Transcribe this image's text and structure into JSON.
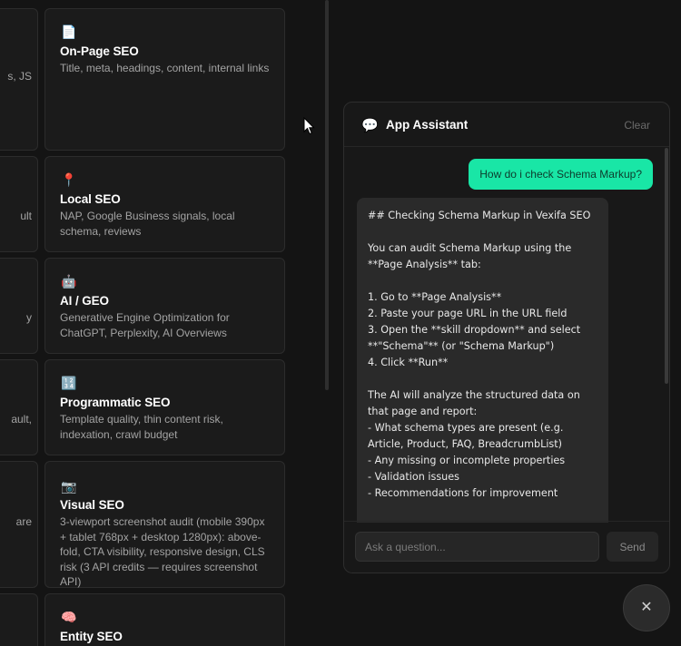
{
  "left_fragments": [
    "s, JS",
    "ult",
    "y",
    "ault,",
    "are"
  ],
  "cards": [
    {
      "icon": "📄",
      "icon_name": "document-icon",
      "title": "On-Page SEO",
      "desc": "Title, meta, headings, content, internal links"
    },
    {
      "icon": "📍",
      "icon_name": "pin-icon",
      "title": "Local SEO",
      "desc": "NAP, Google Business signals, local schema, reviews"
    },
    {
      "icon": "🤖",
      "icon_name": "robot-icon",
      "title": "AI / GEO",
      "desc": "Generative Engine Optimization for ChatGPT, Perplexity, AI Overviews"
    },
    {
      "icon": "🔢",
      "icon_name": "numbers-icon",
      "title": "Programmatic SEO",
      "desc": "Template quality, thin content risk, indexation, crawl budget"
    },
    {
      "icon": "📷",
      "icon_name": "camera-icon",
      "title": "Visual SEO",
      "desc": "3-viewport screenshot audit (mobile 390px + tablet 768px + desktop 1280px): above-fold, CTA visibility, responsive design, CLS risk (3 API credits — requires screenshot API)"
    },
    {
      "icon": "🧠",
      "icon_name": "brain-icon",
      "title": "Entity SEO",
      "desc": ""
    }
  ],
  "chat": {
    "icon_name": "speech-bubble-icon",
    "title": "App Assistant",
    "clear_label": "Clear",
    "user_message": "How do i check Schema Markup?",
    "assistant_message": "## Checking Schema Markup in Vexifa SEO\n\nYou can audit Schema Markup using the **Page Analysis** tab:\n\n1. Go to **Page Analysis**\n2. Paste your page URL in the URL field\n3. Open the **skill dropdown** and select **\"Schema\"** (or \"Schema Markup\")\n4. Click **Run**\n\nThe AI will analyze the structured data on that page and report:\n- What schema types are present (e.g. Article, Product, FAQ, BreadcrumbList)\n- Any missing or incomplete properties\n- Validation issues\n- Recommendations for improvement",
    "input_placeholder": "Ask a question...",
    "send_label": "Send",
    "close_label": "✕"
  },
  "colors": {
    "accent": "#19e6a6",
    "background": "#141414",
    "card": "#1b1b1b",
    "bubble": "#2a2a2a"
  }
}
